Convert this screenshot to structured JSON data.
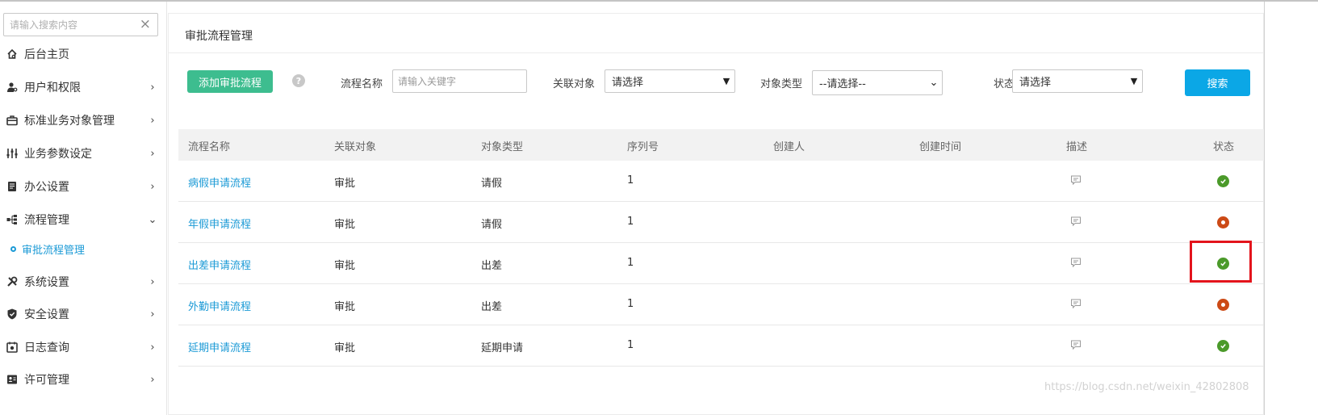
{
  "sidebar": {
    "search_placeholder": "请输入搜索内容",
    "clear_symbol": "×",
    "items": [
      {
        "label": "后台主页",
        "icon": "home-icon",
        "arrow": ""
      },
      {
        "label": "用户和权限",
        "icon": "user-key-icon",
        "arrow": "›"
      },
      {
        "label": "标准业务对象管理",
        "icon": "briefcase-icon",
        "arrow": "›"
      },
      {
        "label": "业务参数设定",
        "icon": "sliders-icon",
        "arrow": "›"
      },
      {
        "label": "办公设置",
        "icon": "document-icon",
        "arrow": "›"
      },
      {
        "label": "流程管理",
        "icon": "flow-icon",
        "arrow": "⌄"
      },
      {
        "label": "系统设置",
        "icon": "tools-icon",
        "arrow": "›"
      },
      {
        "label": "安全设置",
        "icon": "shield-icon",
        "arrow": "›"
      },
      {
        "label": "日志查询",
        "icon": "log-icon",
        "arrow": "›"
      },
      {
        "label": "许可管理",
        "icon": "license-icon",
        "arrow": "›"
      }
    ],
    "sub_item": "审批流程管理"
  },
  "main": {
    "title": "审批流程管理",
    "add_button": "添加审批流程",
    "help_symbol": "?",
    "filters": {
      "name_label": "流程名称",
      "name_placeholder": "请输入关键字",
      "object_label": "关联对象",
      "object_value": "请选择",
      "type_label": "对象类型",
      "type_value": "--请选择--",
      "status_label": "状态",
      "status_value": "请选择"
    },
    "search_button": "搜索"
  },
  "table": {
    "headers": [
      "流程名称",
      "关联对象",
      "对象类型",
      "序列号",
      "创建人",
      "创建时间",
      "描述",
      "状态"
    ],
    "rows": [
      {
        "name": "病假申请流程",
        "object": "审批",
        "type": "请假",
        "seq": "1",
        "creator": "",
        "created": "",
        "status": "enabled"
      },
      {
        "name": "年假申请流程",
        "object": "审批",
        "type": "请假",
        "seq": "1",
        "creator": "",
        "created": "",
        "status": "disabled"
      },
      {
        "name": "出差申请流程",
        "object": "审批",
        "type": "出差",
        "seq": "1",
        "creator": "",
        "created": "",
        "status": "enabled"
      },
      {
        "name": "外勤申请流程",
        "object": "审批",
        "type": "出差",
        "seq": "1",
        "creator": "",
        "created": "",
        "status": "disabled"
      },
      {
        "name": "延期申请流程",
        "object": "审批",
        "type": "延期申请",
        "seq": "1",
        "creator": "",
        "created": "",
        "status": "enabled"
      }
    ]
  },
  "colors": {
    "accent_blue": "#1b9ad6",
    "add_button_green": "#3dbd8f",
    "search_button_blue": "#0ba7e6",
    "status_enabled": "#4b9a2a",
    "status_disabled": "#cc4a16",
    "highlight_red": "#e3141c"
  },
  "watermark": "https://blog.csdn.net/weixin_42802808"
}
